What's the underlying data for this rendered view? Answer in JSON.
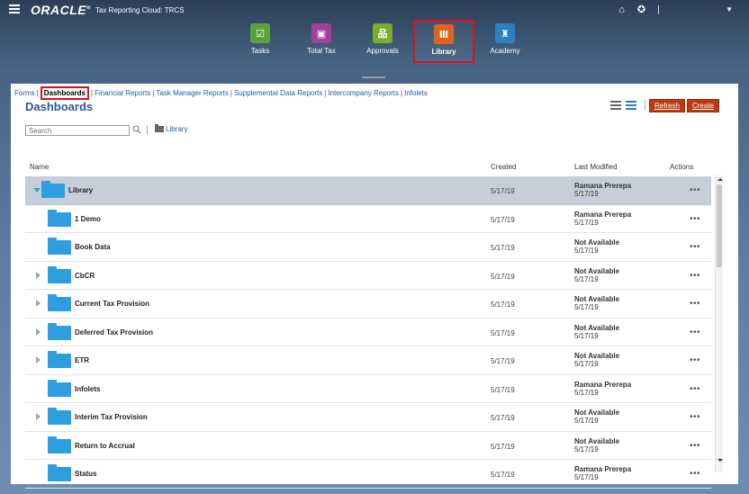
{
  "header": {
    "logo": "ORACLE",
    "logo_mark": "®",
    "app_title": "Tax Reporting Cloud: TRCS",
    "nav_cards": [
      {
        "label": "Tasks",
        "icon": "check-icon",
        "color": "#5aa23a",
        "glyph": "☑"
      },
      {
        "label": "Total Tax",
        "icon": "presentation-icon",
        "color": "#a13f99",
        "glyph": "▣"
      },
      {
        "label": "Approvals",
        "icon": "hierarchy-icon",
        "color": "#7aac2e",
        "glyph": "品"
      },
      {
        "label": "Library",
        "icon": "books-icon",
        "color": "#e06417",
        "glyph": "Ⅲ"
      },
      {
        "label": "Academy",
        "icon": "graduate-icon",
        "color": "#2b7fc4",
        "glyph": "♜"
      }
    ]
  },
  "links": {
    "items": [
      "Forms",
      "Dashboards",
      "Financial Reports",
      "Task Manager Reports",
      "Supplemental Data Reports",
      "Intercompany Reports",
      "Infolets"
    ],
    "current": "Dashboards"
  },
  "page": {
    "title": "Dashboards",
    "search_placeholder": "Search",
    "breadcrumb": "Library",
    "refresh_label": "Refresh",
    "create_label": "Create"
  },
  "table": {
    "columns": {
      "name": "Name",
      "created": "Created",
      "modified": "Last Modified",
      "actions": "Actions"
    },
    "rows": [
      {
        "name": "Library",
        "created": "5/17/19",
        "by": "Ramana Prerepa",
        "date": "5/17/19",
        "expand": "open",
        "indent": 0,
        "selected": true
      },
      {
        "name": "1 Demo",
        "created": "5/17/19",
        "by": "Ramana Prerepa",
        "date": "5/17/19",
        "expand": "none",
        "indent": 1
      },
      {
        "name": "Book Data",
        "created": "5/17/19",
        "by": "Not Available",
        "date": "5/17/19",
        "expand": "none",
        "indent": 1
      },
      {
        "name": "CbCR",
        "created": "5/17/19",
        "by": "Not Available",
        "date": "5/17/19",
        "expand": "closed",
        "indent": 1
      },
      {
        "name": "Current Tax Provision",
        "created": "5/17/19",
        "by": "Not Available",
        "date": "5/17/19",
        "expand": "closed",
        "indent": 1
      },
      {
        "name": "Deferred Tax Provision",
        "created": "5/17/19",
        "by": "Not Available",
        "date": "5/17/19",
        "expand": "closed",
        "indent": 1
      },
      {
        "name": "ETR",
        "created": "5/17/19",
        "by": "Not Available",
        "date": "5/17/19",
        "expand": "closed",
        "indent": 1
      },
      {
        "name": "Infolets",
        "created": "5/17/19",
        "by": "Ramana Prerepa",
        "date": "5/17/19",
        "expand": "none",
        "indent": 1
      },
      {
        "name": "Interim Tax Provision",
        "created": "5/17/19",
        "by": "Not Available",
        "date": "5/17/19",
        "expand": "closed",
        "indent": 1
      },
      {
        "name": "Return to Accrual",
        "created": "5/17/19",
        "by": "Not Available",
        "date": "5/17/19",
        "expand": "none",
        "indent": 1
      },
      {
        "name": "Status",
        "created": "5/17/19",
        "by": "Ramana Prerepa",
        "date": "5/17/19",
        "expand": "none",
        "indent": 1
      }
    ],
    "actions_glyph": "•••"
  }
}
